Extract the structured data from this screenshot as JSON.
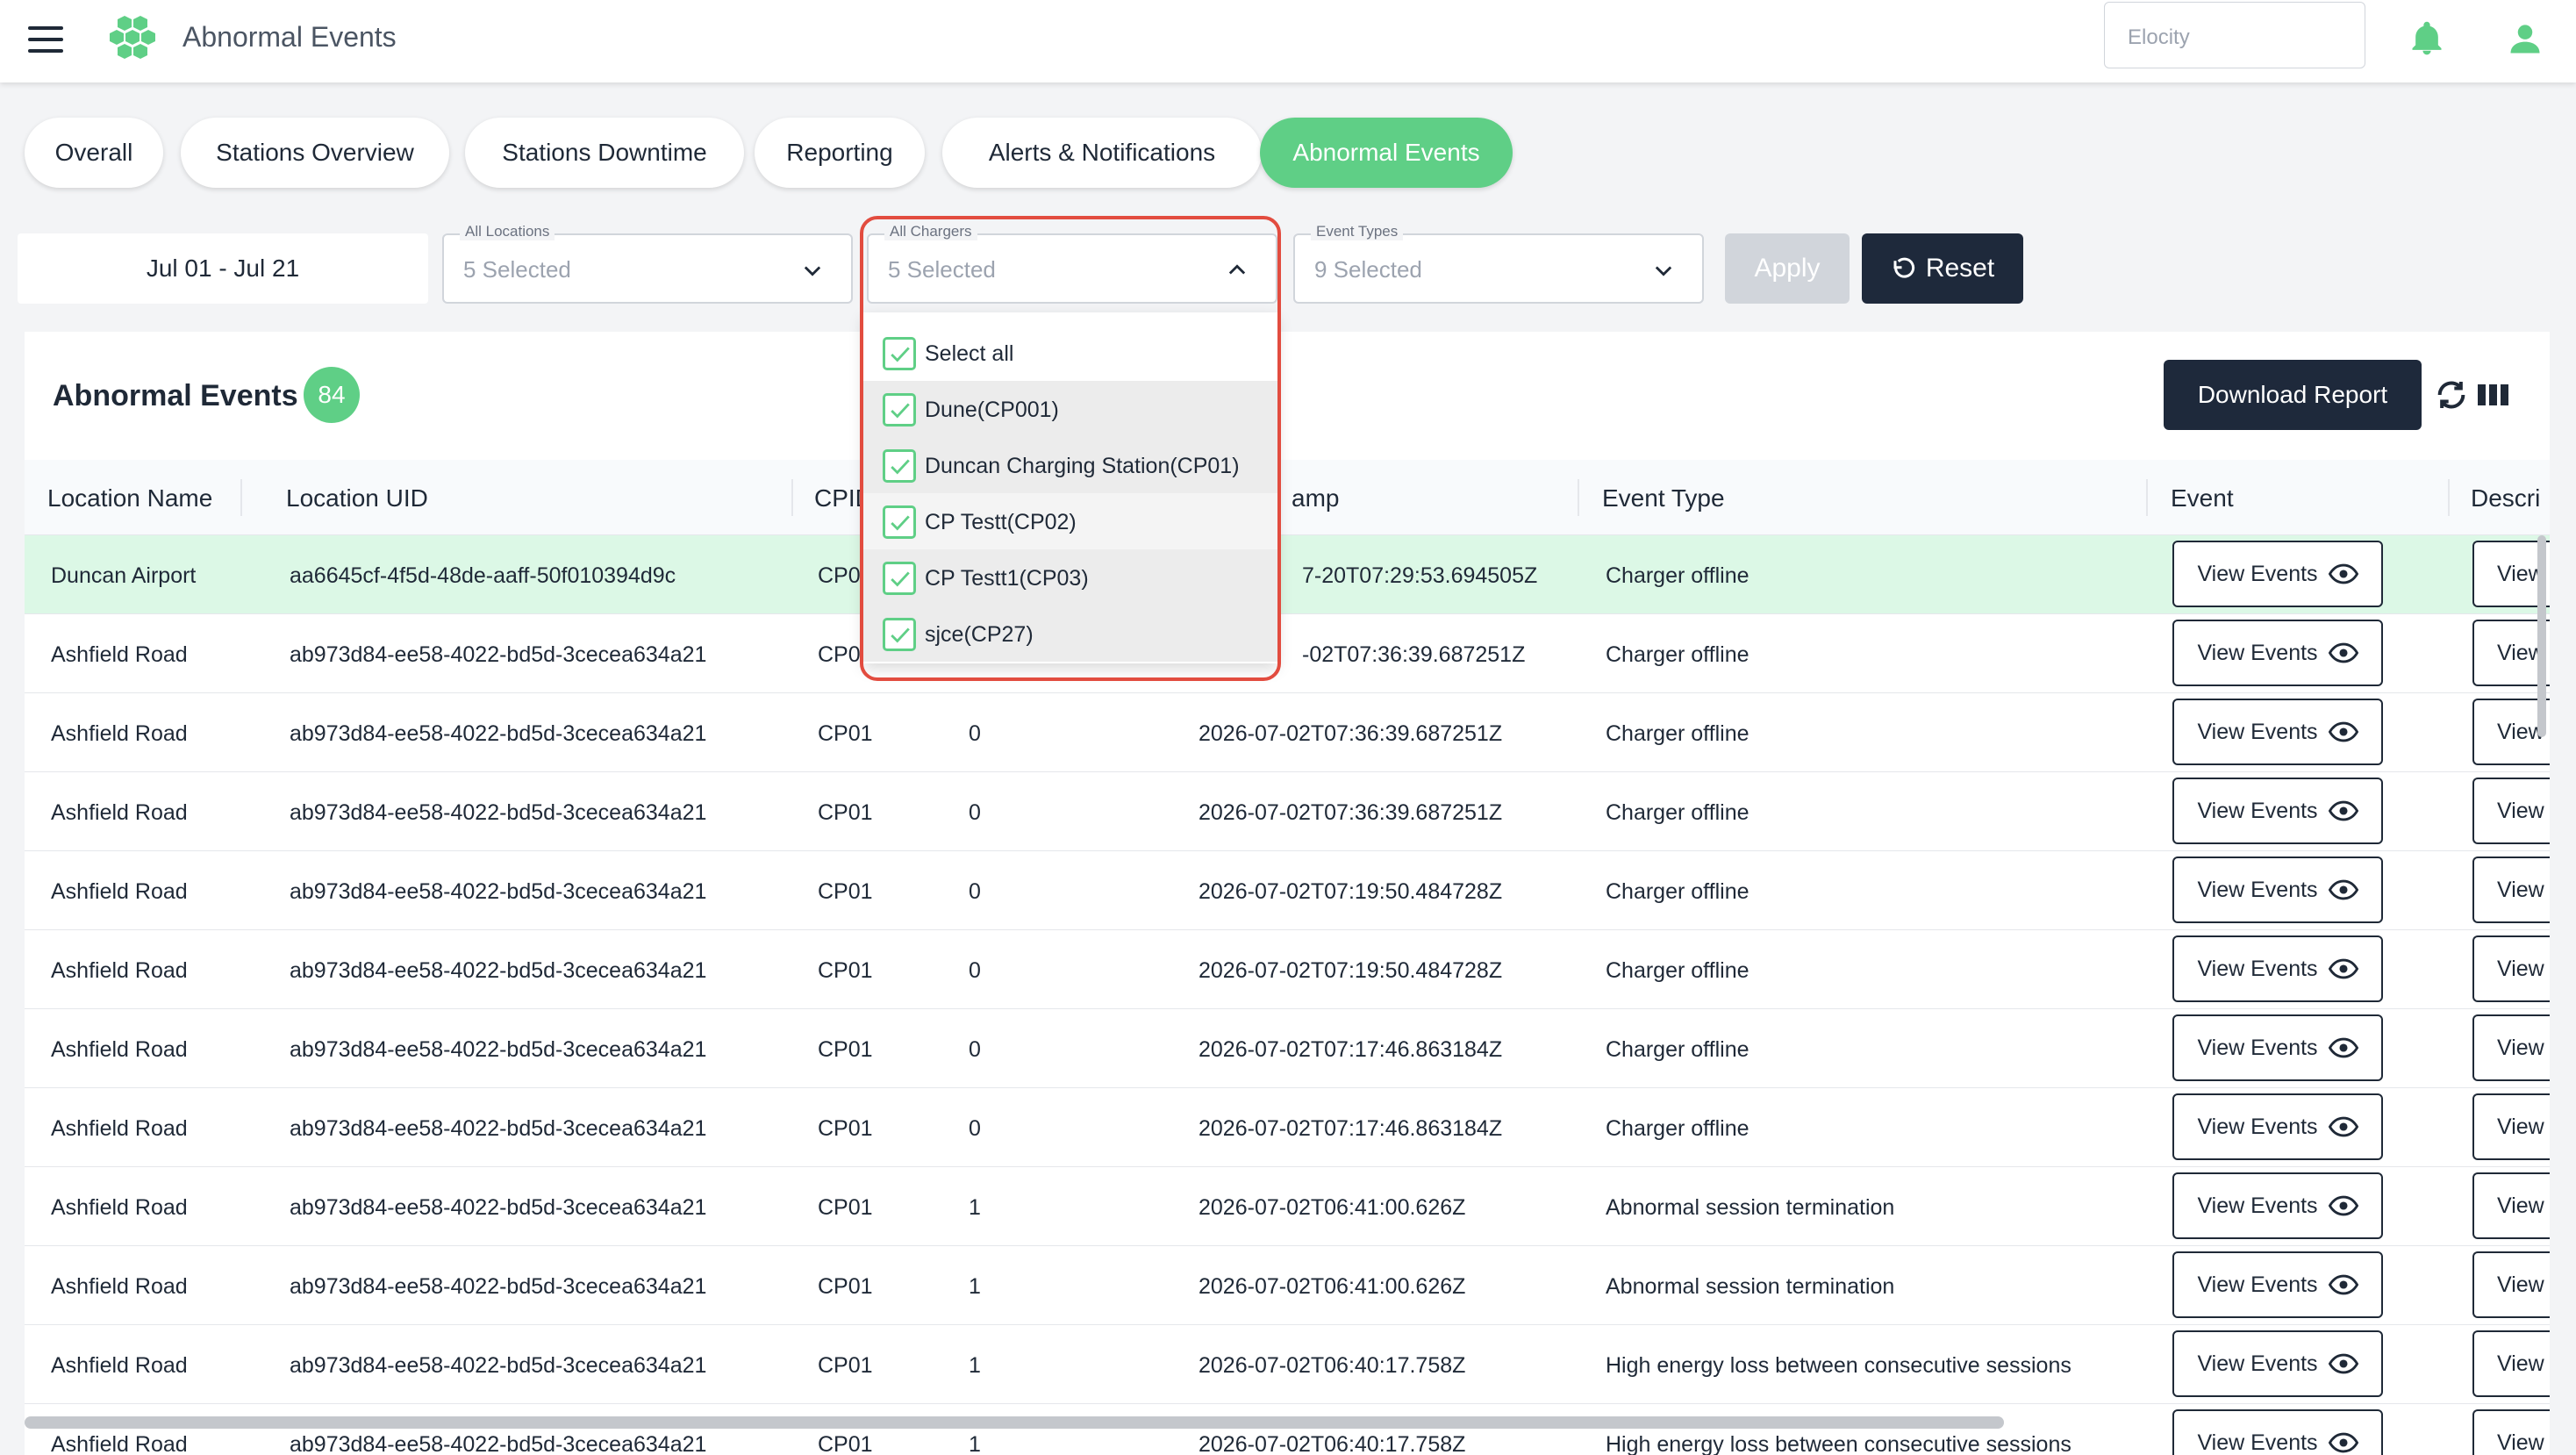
{
  "app": {
    "title": "Abnormal Events",
    "org_placeholder": "Elocity"
  },
  "tabs": [
    {
      "label": "Overall"
    },
    {
      "label": "Stations Overview"
    },
    {
      "label": "Stations Downtime"
    },
    {
      "label": "Reporting"
    },
    {
      "label": "Alerts & Notifications"
    },
    {
      "label": "Abnormal Events",
      "active": true
    }
  ],
  "filters": {
    "date_range": "Jul 01 - Jul 21",
    "locations": {
      "label": "All Locations",
      "value": "5 Selected"
    },
    "chargers": {
      "label": "All Chargers",
      "value": "5 Selected"
    },
    "event_types": {
      "label": "Event Types",
      "value": "9 Selected"
    },
    "apply_label": "Apply",
    "reset_label": "Reset"
  },
  "chargers_dropdown": {
    "items": [
      {
        "label": "Select all",
        "checked": true
      },
      {
        "label": "Dune(CP001)",
        "checked": true
      },
      {
        "label": "Duncan Charging Station(CP01)",
        "checked": true
      },
      {
        "label": "CP Testt(CP02)",
        "checked": true
      },
      {
        "label": "CP Testt1(CP03)",
        "checked": true
      },
      {
        "label": "sjce(CP27)",
        "checked": true
      }
    ]
  },
  "card": {
    "title": "Abnormal Events",
    "count": "84",
    "download_label": "Download Report"
  },
  "table": {
    "columns": [
      "Location Name",
      "Location UID",
      "CPID",
      "amp",
      "Event Type",
      "Event",
      "Descri"
    ],
    "view_events_label": "View Events",
    "view_partial_label": "View",
    "rows": [
      {
        "location": "Duncan Airport",
        "uid": "aa6645cf-4f5d-48de-aaff-50f010394d9c",
        "cpid": "CP0",
        "conn": "",
        "timestamp": "7-20T07:29:53.694505Z",
        "event_type": "Charger offline",
        "highlight": true
      },
      {
        "location": "Ashfield Road",
        "uid": "ab973d84-ee58-4022-bd5d-3cecea634a21",
        "cpid": "CP0",
        "conn": "",
        "timestamp": "-02T07:36:39.687251Z",
        "event_type": "Charger offline"
      },
      {
        "location": "Ashfield Road",
        "uid": "ab973d84-ee58-4022-bd5d-3cecea634a21",
        "cpid": "CP01",
        "conn": "0",
        "timestamp": "2026-07-02T07:36:39.687251Z",
        "event_type": "Charger offline"
      },
      {
        "location": "Ashfield Road",
        "uid": "ab973d84-ee58-4022-bd5d-3cecea634a21",
        "cpid": "CP01",
        "conn": "0",
        "timestamp": "2026-07-02T07:36:39.687251Z",
        "event_type": "Charger offline"
      },
      {
        "location": "Ashfield Road",
        "uid": "ab973d84-ee58-4022-bd5d-3cecea634a21",
        "cpid": "CP01",
        "conn": "0",
        "timestamp": "2026-07-02T07:19:50.484728Z",
        "event_type": "Charger offline"
      },
      {
        "location": "Ashfield Road",
        "uid": "ab973d84-ee58-4022-bd5d-3cecea634a21",
        "cpid": "CP01",
        "conn": "0",
        "timestamp": "2026-07-02T07:19:50.484728Z",
        "event_type": "Charger offline"
      },
      {
        "location": "Ashfield Road",
        "uid": "ab973d84-ee58-4022-bd5d-3cecea634a21",
        "cpid": "CP01",
        "conn": "0",
        "timestamp": "2026-07-02T07:17:46.863184Z",
        "event_type": "Charger offline"
      },
      {
        "location": "Ashfield Road",
        "uid": "ab973d84-ee58-4022-bd5d-3cecea634a21",
        "cpid": "CP01",
        "conn": "0",
        "timestamp": "2026-07-02T07:17:46.863184Z",
        "event_type": "Charger offline"
      },
      {
        "location": "Ashfield Road",
        "uid": "ab973d84-ee58-4022-bd5d-3cecea634a21",
        "cpid": "CP01",
        "conn": "1",
        "timestamp": "2026-07-02T06:41:00.626Z",
        "event_type": "Abnormal session termination"
      },
      {
        "location": "Ashfield Road",
        "uid": "ab973d84-ee58-4022-bd5d-3cecea634a21",
        "cpid": "CP01",
        "conn": "1",
        "timestamp": "2026-07-02T06:41:00.626Z",
        "event_type": "Abnormal session termination"
      },
      {
        "location": "Ashfield Road",
        "uid": "ab973d84-ee58-4022-bd5d-3cecea634a21",
        "cpid": "CP01",
        "conn": "1",
        "timestamp": "2026-07-02T06:40:17.758Z",
        "event_type": "High energy loss between consecutive sessions"
      },
      {
        "location": "Ashfield Road",
        "uid": "ab973d84-ee58-4022-bd5d-3cecea634a21",
        "cpid": "CP01",
        "conn": "1",
        "timestamp": "2026-07-02T06:40:17.758Z",
        "event_type": "High energy loss between consecutive sessions"
      }
    ]
  },
  "colors": {
    "accent": "#5fcf86",
    "dark": "#1e293b",
    "highlight_row": "#dcf8e6",
    "callout": "#e24c3f"
  }
}
